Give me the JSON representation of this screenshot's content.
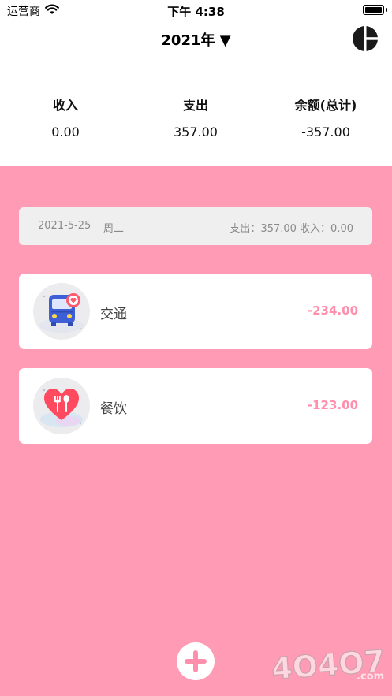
{
  "status_bar": {
    "carrier": "运营商",
    "time": "下午 4:38"
  },
  "header": {
    "year_label": "2021年 ▼",
    "chart_icon": "pie-chart-icon"
  },
  "summary": {
    "income_label": "收入",
    "income_value": "0.00",
    "expense_label": "支出",
    "expense_value": "357.00",
    "balance_label": "余额(总计)",
    "balance_value": "-357.00"
  },
  "day_group": {
    "date": "2021-5-25",
    "weekday": "周二",
    "totals": "支出：357.00  收入：0.00"
  },
  "entries": [
    {
      "name": "交通",
      "amount": "-234.00",
      "icon": "bus-icon"
    },
    {
      "name": "餐饮",
      "amount": "-123.00",
      "icon": "dining-heart-icon"
    }
  ],
  "add_button_icon": "plus-icon",
  "watermark": "4O4O7.com",
  "colors": {
    "accent_pink": "#ff9bb4",
    "amount_pink": "#ff8fad",
    "card": "#ffffff"
  }
}
